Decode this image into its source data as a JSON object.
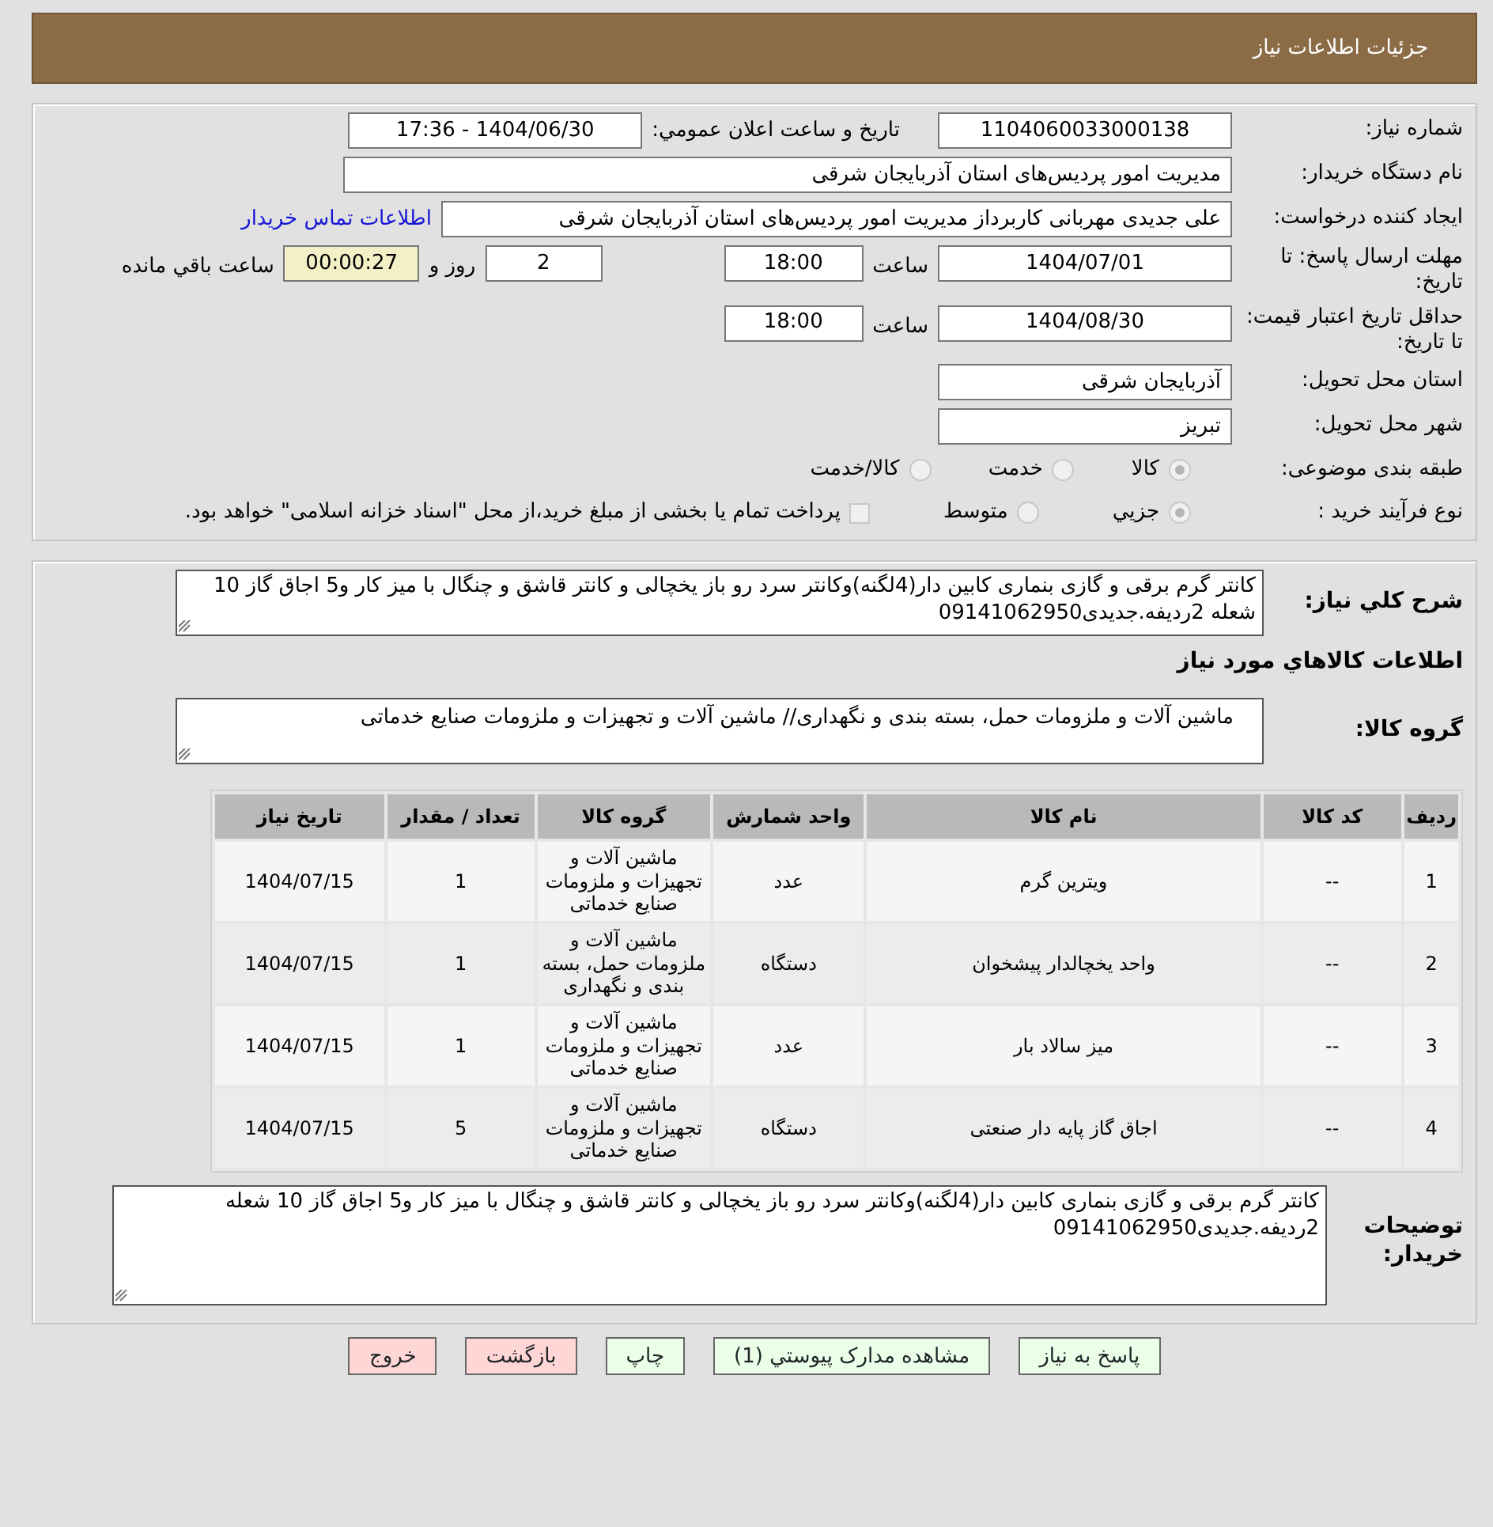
{
  "header": {
    "title": "جزئیات اطلاعات نیاز"
  },
  "need_number": {
    "label": "شماره نیاز:",
    "value": "1104060033000138"
  },
  "announce": {
    "label": "تاریخ و ساعت اعلان عمومي:",
    "value": "1404/06/30 - 17:36"
  },
  "buyer": {
    "label": "نام دستگاه خریدار:",
    "value": "مدیریت امور پردیس‌های استان آذربایجان شرقی"
  },
  "requester": {
    "label": "ایجاد کننده درخواست:",
    "value": "علی جدیدی مهربانی کاربرداز مدیریت امور پردیس‌های استان آذربایجان شرقی",
    "link": "اطلاعات تماس خریدار"
  },
  "reply_deadline": {
    "label": "مهلت ارسال پاسخ: تا تاریخ:",
    "date": "1404/07/01",
    "time_label": "ساعت",
    "time": "18:00",
    "days": "2",
    "days_label": "روز و",
    "remaining": "00:00:27",
    "remaining_label": "ساعت باقي مانده"
  },
  "price_validity": {
    "label": "حداقل تاریخ اعتبار قیمت: تا تاریخ:",
    "date": "1404/08/30",
    "time_label": "ساعت",
    "time": "18:00"
  },
  "province": {
    "label": "استان محل تحویل:",
    "value": "آذربایجان شرقی"
  },
  "city": {
    "label": "شهر محل تحویل:",
    "value": "تبریز"
  },
  "category": {
    "label": "طبقه بندی موضوعی:",
    "options": [
      {
        "label": "کالا",
        "selected": true
      },
      {
        "label": "خدمت",
        "selected": false
      },
      {
        "label": "کالا/خدمت",
        "selected": false
      }
    ]
  },
  "purchase_type": {
    "label": "نوع فرآیند خرید :",
    "options": [
      {
        "label": "جزيي",
        "selected": true
      },
      {
        "label": "متوسط",
        "selected": false
      }
    ],
    "checkbox": {
      "label": "پرداخت تمام یا بخشی از مبلغ خرید،از محل \"اسناد خزانه اسلامی\" خواهد بود.",
      "checked": false
    }
  },
  "summary": {
    "label": "شرح كلي نياز:",
    "value": "کانتر گرم برقی و گازی بنماری کابین دار(4لگنه)وکانتر سرد رو باز یخچالی و کانتر قاشق و چنگال با میز کار و5 اجاق گاز 10 شعله 2ردیفه.جدیدی09141062950"
  },
  "items_title": "اطلاعات كالاهاي مورد نياز",
  "goods_group": {
    "label": "گروه کالا:",
    "value": "ماشین آلات و ملزومات حمل، بسته بندی و نگهداری// ماشین آلات و تجهیزات و ملزومات صنایع خدماتی"
  },
  "table": {
    "columns": [
      "ردیف",
      "کد کالا",
      "نام کالا",
      "واحد شمارش",
      "گروه کالا",
      "تعداد / مقدار",
      "تاریخ نیاز"
    ],
    "rows": [
      [
        "1",
        "--",
        "ویترین گرم",
        "عدد",
        "ماشین آلات و تجهیزات و ملزومات صنایع خدماتی",
        "1",
        "1404/07/15"
      ],
      [
        "2",
        "--",
        "واحد یخچالدار پیشخوان",
        "دستگاه",
        "ماشین آلات و ملزومات حمل، بسته بندی و نگهداری",
        "1",
        "1404/07/15"
      ],
      [
        "3",
        "--",
        "میز سالاد بار",
        "عدد",
        "ماشین آلات و تجهیزات و ملزومات صنایع خدماتی",
        "1",
        "1404/07/15"
      ],
      [
        "4",
        "--",
        "اجاق گاز پایه دار صنعتی",
        "دستگاه",
        "ماشین آلات و تجهیزات و ملزومات صنایع خدماتی",
        "5",
        "1404/07/15"
      ]
    ]
  },
  "buyer_notes": {
    "label": "توضیحات خریدار:",
    "value": "کانتر گرم برقی و گازی بنماری کابین دار(4لگنه)وکانتر سرد رو باز یخچالی و کانتر قاشق و چنگال با میز کار و5 اجاق گاز 10 شعله 2ردیفه.جدیدی09141062950"
  },
  "buttons": [
    {
      "label": "پاسخ به نیاز",
      "kind": "action"
    },
    {
      "label": "مشاهده مدارک پیوستي (1)",
      "kind": "action"
    },
    {
      "label": "چاپ",
      "kind": "action"
    },
    {
      "label": "بازگشت",
      "kind": "danger"
    },
    {
      "label": "خروج",
      "kind": "danger"
    }
  ]
}
